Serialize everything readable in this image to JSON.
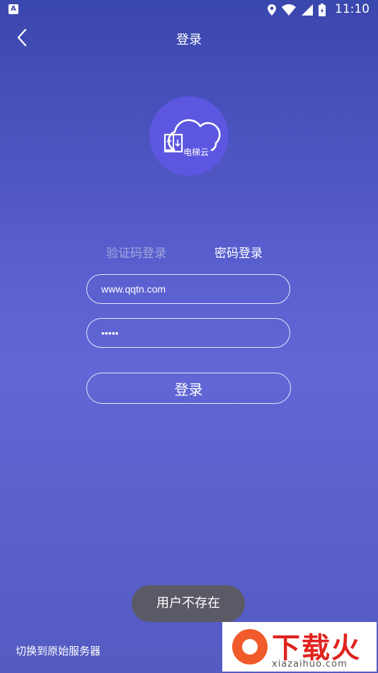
{
  "status_bar": {
    "time": "11:10",
    "left_icon_label": "A"
  },
  "header": {
    "title": "登录"
  },
  "logo": {
    "text": "电梯云"
  },
  "tabs": [
    {
      "label": "验证码登录",
      "active": false
    },
    {
      "label": "密码登录",
      "active": true
    }
  ],
  "form": {
    "username_value": "www.qqtn.com",
    "password_value": "•••••"
  },
  "login_button": {
    "label": "登录"
  },
  "toast": {
    "text": "用户不存在"
  },
  "footer": {
    "switch_server": "切换到原始服务器"
  },
  "watermark": {
    "brand": "下载火",
    "url": "xiazaihuo.com"
  },
  "colors": {
    "background_top": "#3a47ad",
    "background_mid": "#6266d6",
    "logo": "#5c56e0",
    "toast": "#5a5a66",
    "watermark_brand": "#e0241f"
  }
}
